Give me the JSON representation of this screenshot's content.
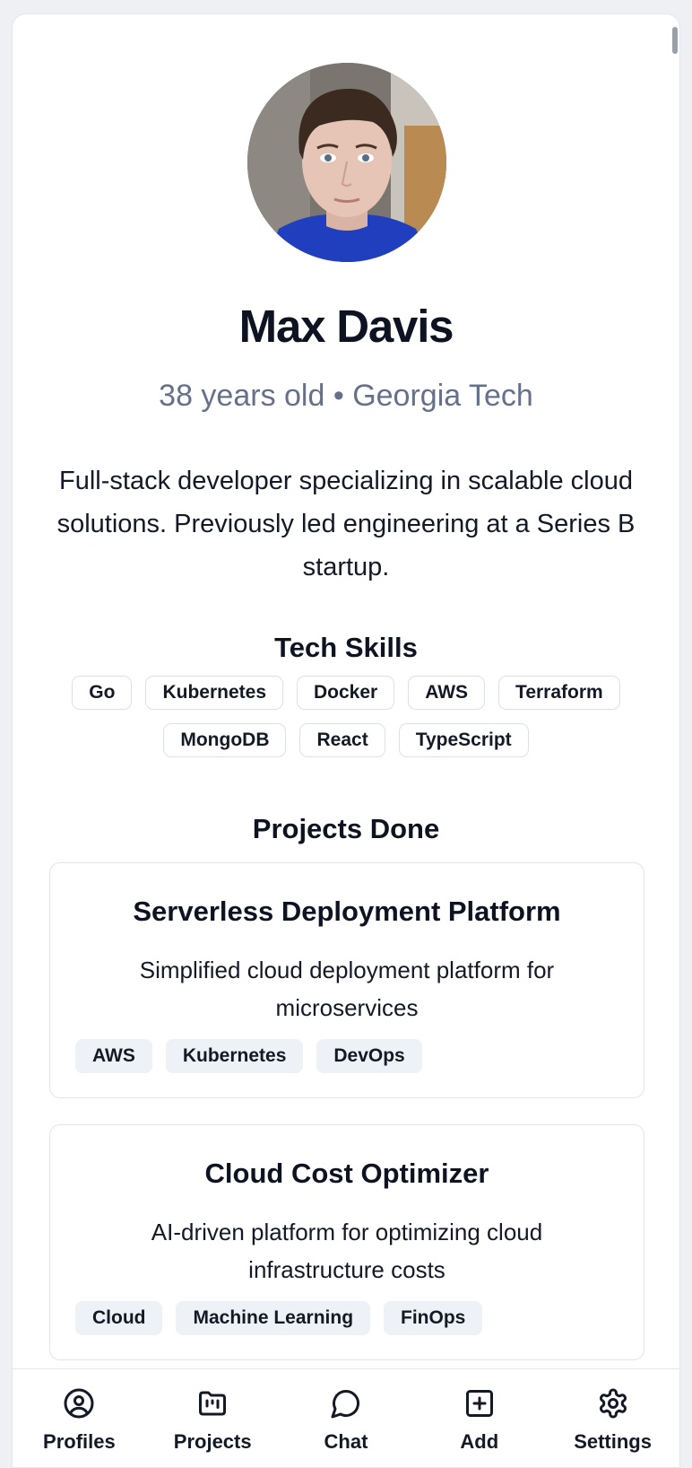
{
  "profile": {
    "name": "Max Davis",
    "meta": "38 years old • Georgia Tech",
    "bio": "Full-stack developer specializing in scalable cloud solutions. Previously led engineering at a Series B startup."
  },
  "skills": {
    "title": "Tech Skills",
    "items": [
      "Go",
      "Kubernetes",
      "Docker",
      "AWS",
      "Terraform",
      "MongoDB",
      "React",
      "TypeScript"
    ]
  },
  "projects": {
    "title": "Projects Done",
    "items": [
      {
        "title": "Serverless Deployment Platform",
        "description": "Simplified cloud deployment platform for microservices",
        "tags": [
          "AWS",
          "Kubernetes",
          "DevOps"
        ]
      },
      {
        "title": "Cloud Cost Optimizer",
        "description": "AI-driven platform for optimizing cloud infrastructure costs",
        "tags": [
          "Cloud",
          "Machine Learning",
          "FinOps"
        ]
      }
    ]
  },
  "nav": {
    "items": [
      {
        "label": "Profiles",
        "icon": "user-circle-icon"
      },
      {
        "label": "Projects",
        "icon": "folder-icon"
      },
      {
        "label": "Chat",
        "icon": "chat-bubble-icon"
      },
      {
        "label": "Add",
        "icon": "plus-square-icon"
      },
      {
        "label": "Settings",
        "icon": "gear-icon"
      }
    ]
  }
}
